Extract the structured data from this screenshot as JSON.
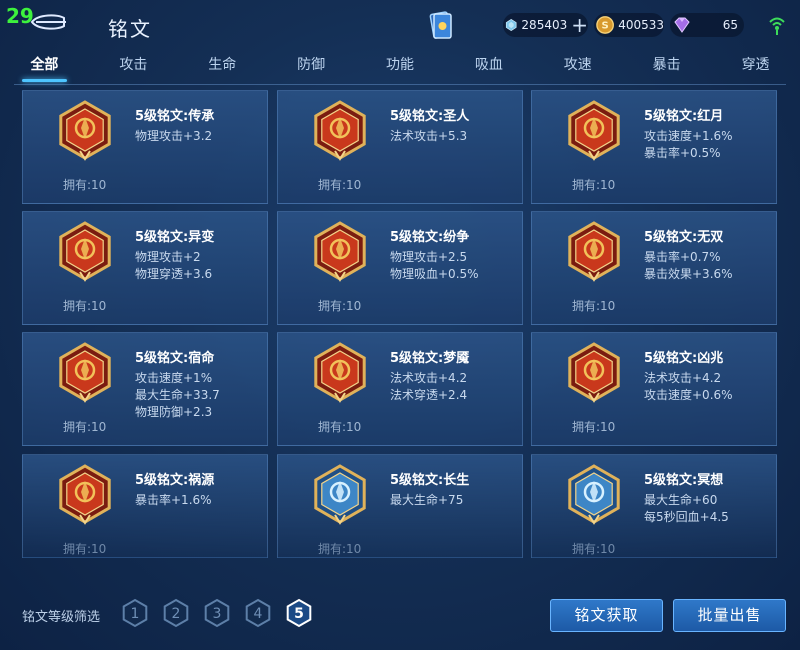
{
  "header": {
    "fps": "29",
    "title": "铭文"
  },
  "currency": {
    "diamond": "285403",
    "gold": "400533",
    "gem": "65"
  },
  "tabs": [
    {
      "label": "全部",
      "active": true
    },
    {
      "label": "攻击",
      "active": false
    },
    {
      "label": "生命",
      "active": false
    },
    {
      "label": "防御",
      "active": false
    },
    {
      "label": "功能",
      "active": false
    },
    {
      "label": "吸血",
      "active": false
    },
    {
      "label": "攻速",
      "active": false
    },
    {
      "label": "暴击",
      "active": false
    },
    {
      "label": "穿透",
      "active": false
    }
  ],
  "runes": [
    {
      "name": "5级铭文:传承",
      "stats": [
        "物理攻击+3.2"
      ],
      "owned": "拥有:10",
      "color": "red",
      "icon": "legacy-rune-icon"
    },
    {
      "name": "5级铭文:圣人",
      "stats": [
        "法术攻击+5.3"
      ],
      "owned": "拥有:10",
      "color": "red",
      "icon": "sage-rune-icon"
    },
    {
      "name": "5级铭文:红月",
      "stats": [
        "攻击速度+1.6%",
        "暴击率+0.5%"
      ],
      "owned": "拥有:10",
      "color": "red",
      "icon": "red-moon-rune-icon"
    },
    {
      "name": "5级铭文:异变",
      "stats": [
        "物理攻击+2",
        "物理穿透+3.6"
      ],
      "owned": "拥有:10",
      "color": "red",
      "icon": "mutation-rune-icon"
    },
    {
      "name": "5级铭文:纷争",
      "stats": [
        "物理攻击+2.5",
        "物理吸血+0.5%"
      ],
      "owned": "拥有:10",
      "color": "red",
      "icon": "strife-rune-icon"
    },
    {
      "name": "5级铭文:无双",
      "stats": [
        "暴击率+0.7%",
        "暴击效果+3.6%"
      ],
      "owned": "拥有:10",
      "color": "red",
      "icon": "peerless-rune-icon"
    },
    {
      "name": "5级铭文:宿命",
      "stats": [
        "攻击速度+1%",
        "最大生命+33.7",
        "物理防御+2.3"
      ],
      "owned": "拥有:10",
      "color": "red",
      "icon": "fate-rune-icon"
    },
    {
      "name": "5级铭文:梦魇",
      "stats": [
        "法术攻击+4.2",
        "法术穿透+2.4"
      ],
      "owned": "拥有:10",
      "color": "red",
      "icon": "nightmare-rune-icon"
    },
    {
      "name": "5级铭文:凶兆",
      "stats": [
        "法术攻击+4.2",
        "攻击速度+0.6%"
      ],
      "owned": "拥有:10",
      "color": "red",
      "icon": "omen-rune-icon"
    },
    {
      "name": "5级铭文:祸源",
      "stats": [
        "暴击率+1.6%"
      ],
      "owned": "拥有:10",
      "color": "red",
      "icon": "calamity-rune-icon"
    },
    {
      "name": "5级铭文:长生",
      "stats": [
        "最大生命+75"
      ],
      "owned": "拥有:10",
      "color": "blue",
      "icon": "longevity-rune-icon"
    },
    {
      "name": "5级铭文:冥想",
      "stats": [
        "最大生命+60",
        "每5秒回血+4.5"
      ],
      "owned": "拥有:10",
      "color": "blue",
      "icon": "meditation-rune-icon"
    }
  ],
  "footer": {
    "filter_label": "铭文等级筛选",
    "levels": [
      "1",
      "2",
      "3",
      "4",
      "5"
    ],
    "selected_level": "5",
    "obtain_button": "铭文获取",
    "sell_button": "批量出售"
  },
  "colors": {
    "accent": "#4ec5ff",
    "red_badge": "#c9381c",
    "gold_border": "#e0b25a",
    "blue_badge": "#3d86c6"
  }
}
